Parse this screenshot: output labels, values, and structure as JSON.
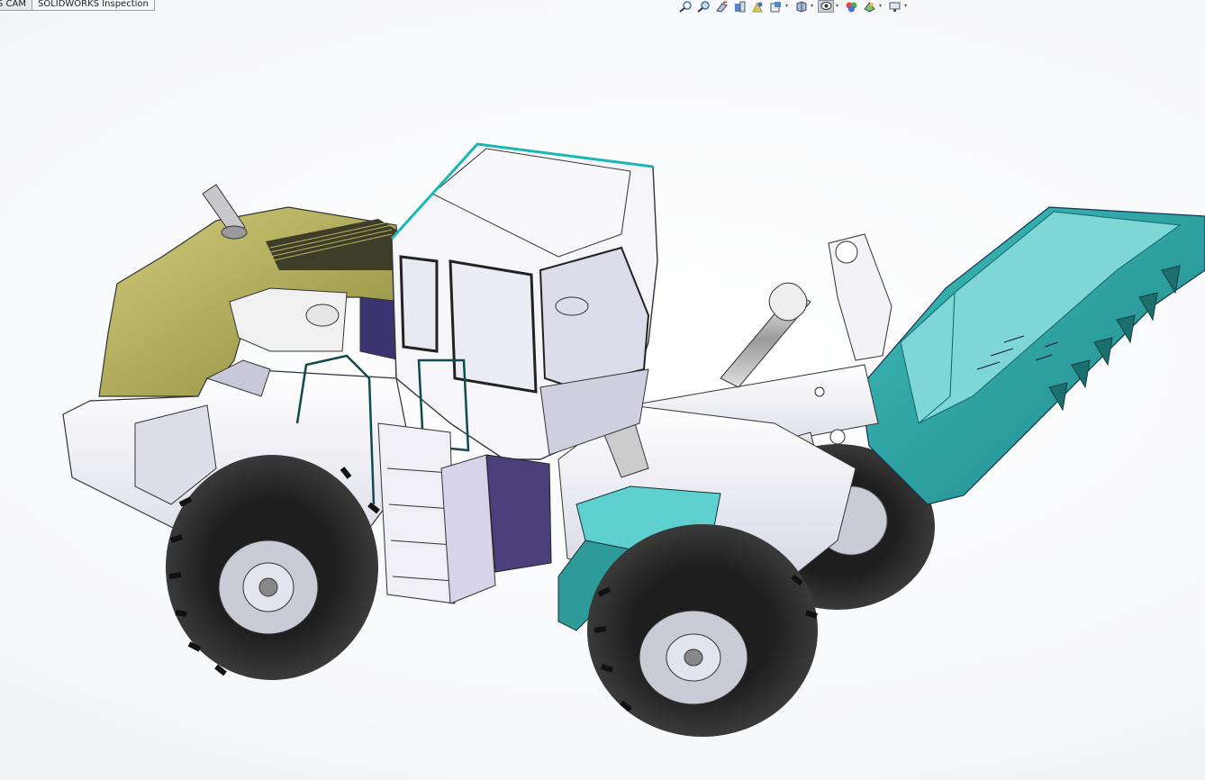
{
  "tabs": [
    {
      "label": "S CAM"
    },
    {
      "label": "SOLIDWORKS Inspection"
    }
  ],
  "heads_up_toolbar": [
    {
      "icon": "zoom-to-fit-icon"
    },
    {
      "icon": "zoom-to-area-icon"
    },
    {
      "icon": "previous-view-icon"
    },
    {
      "icon": "section-view-icon"
    },
    {
      "icon": "dynamic-annotation-views-icon"
    },
    {
      "icon": "view-orientation-icon",
      "dropdown": true
    },
    {
      "icon": "display-style-icon",
      "dropdown": true
    },
    {
      "icon": "hide-show-items-icon",
      "dropdown": true,
      "active": true
    },
    {
      "icon": "edit-appearance-icon"
    },
    {
      "icon": "apply-scene-icon",
      "dropdown": true
    },
    {
      "icon": "view-settings-icon",
      "dropdown": true
    }
  ],
  "model": {
    "colors": {
      "rear_hood": "#b8b45a",
      "bucket": "#2fa5a5",
      "body": "#f1f1f5",
      "cab_frame": "#d9d9e6",
      "tire": "#2a2a2a",
      "rim": "#c9cbd6",
      "shadow_panel": "#6e64a0",
      "selection_edge": "#1bb6b6"
    }
  }
}
